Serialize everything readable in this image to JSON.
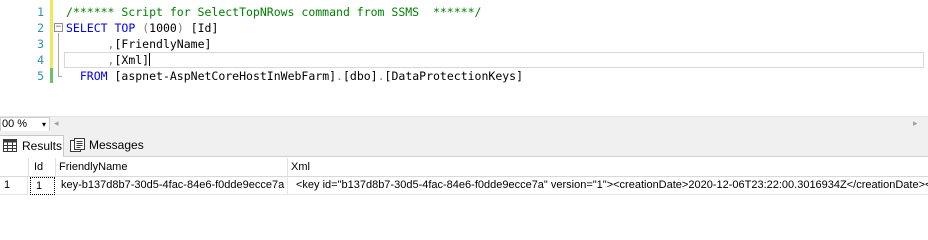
{
  "editor": {
    "lines": [
      {
        "number": "1",
        "parts": [
          {
            "c": "cm",
            "t": "/****** Script for SelectTopNRows command from SSMS  ******/"
          }
        ]
      },
      {
        "number": "2",
        "fold": "−",
        "parts": [
          {
            "c": "kw",
            "t": "SELECT"
          },
          {
            "c": "tx",
            "t": " "
          },
          {
            "c": "kw",
            "t": "TOP"
          },
          {
            "c": "tx",
            "t": " "
          },
          {
            "c": "gr",
            "t": "("
          },
          {
            "c": "tx",
            "t": "1000"
          },
          {
            "c": "gr",
            "t": ")"
          },
          {
            "c": "tx",
            "t": " [Id]"
          }
        ]
      },
      {
        "number": "3",
        "parts": [
          {
            "c": "tx",
            "t": "      "
          },
          {
            "c": "gr",
            "t": ","
          },
          {
            "c": "tx",
            "t": "[FriendlyName]"
          }
        ]
      },
      {
        "number": "4",
        "caret": true,
        "parts": [
          {
            "c": "tx",
            "t": "      "
          },
          {
            "c": "gr",
            "t": ","
          },
          {
            "c": "tx",
            "t": "[Xml]"
          }
        ]
      },
      {
        "number": "5",
        "parts": [
          {
            "c": "tx",
            "t": "  "
          },
          {
            "c": "kw",
            "t": "FROM"
          },
          {
            "c": "tx",
            "t": " [aspnet-AspNetCoreHostInWebFarm]"
          },
          {
            "c": "gr",
            "t": "."
          },
          {
            "c": "tx",
            "t": "[dbo]"
          },
          {
            "c": "gr",
            "t": "."
          },
          {
            "c": "tx",
            "t": "[DataProtectionKeys]"
          }
        ]
      }
    ]
  },
  "zoom": {
    "value": "00 %",
    "arrow": "▾"
  },
  "scroll": {
    "left": "◂",
    "right": "▸"
  },
  "tabs": {
    "results": "Results",
    "messages": "Messages"
  },
  "grid": {
    "columns": {
      "id": "Id",
      "friendly_name": "FriendlyName",
      "xml": "Xml"
    },
    "rows": [
      {
        "row_number": "1",
        "id": "1",
        "friendly_name": "key-b137d8b7-30d5-4fac-84e6-f0dde9ecce7a",
        "xml": "<key id=\"b137d8b7-30d5-4fac-84e6-f0dde9ecce7a\" version=\"1\"><creationDate>2020-12-06T23:22:00.3016934Z</creationDate><a"
      }
    ]
  },
  "colors": {
    "keyword": "#0000ff",
    "comment": "#008000",
    "line_number": "#2b91af",
    "operator": "#808080"
  }
}
